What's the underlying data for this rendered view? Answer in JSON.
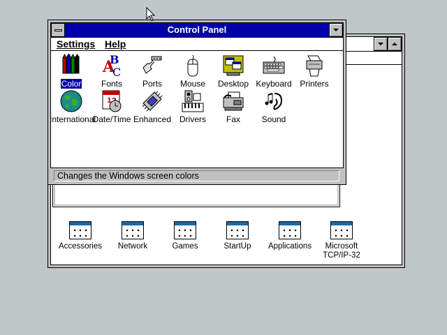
{
  "program_manager": {
    "groups": [
      {
        "label": "Accessories"
      },
      {
        "label": "Network"
      },
      {
        "label": "Games"
      },
      {
        "label": "StartUp"
      },
      {
        "label": "Applications"
      },
      {
        "label": "Microsoft TCP/IP-32"
      }
    ]
  },
  "control_panel": {
    "title": "Control Panel",
    "menu": {
      "settings": "Settings",
      "help": "Help"
    },
    "items": [
      {
        "label": "Color",
        "icon": "color-icon",
        "selected": true
      },
      {
        "label": "Fonts",
        "icon": "fonts-icon"
      },
      {
        "label": "Ports",
        "icon": "ports-icon"
      },
      {
        "label": "Mouse",
        "icon": "mouse-icon"
      },
      {
        "label": "Desktop",
        "icon": "desktop-icon"
      },
      {
        "label": "Keyboard",
        "icon": "keyboard-icon"
      },
      {
        "label": "Printers",
        "icon": "printers-icon"
      },
      {
        "label": "International",
        "icon": "international-icon"
      },
      {
        "label": "Date/Time",
        "icon": "date-time-icon"
      },
      {
        "label": "Enhanced",
        "icon": "enhanced-icon"
      },
      {
        "label": "Drivers",
        "icon": "drivers-icon"
      },
      {
        "label": "Fax",
        "icon": "fax-icon"
      },
      {
        "label": "Sound",
        "icon": "sound-icon"
      }
    ],
    "status": "Changes the Windows screen colors"
  },
  "colors": {
    "desktop": "#c0c7c8",
    "active_title": "#0000a8",
    "selection": "#0000a8"
  }
}
